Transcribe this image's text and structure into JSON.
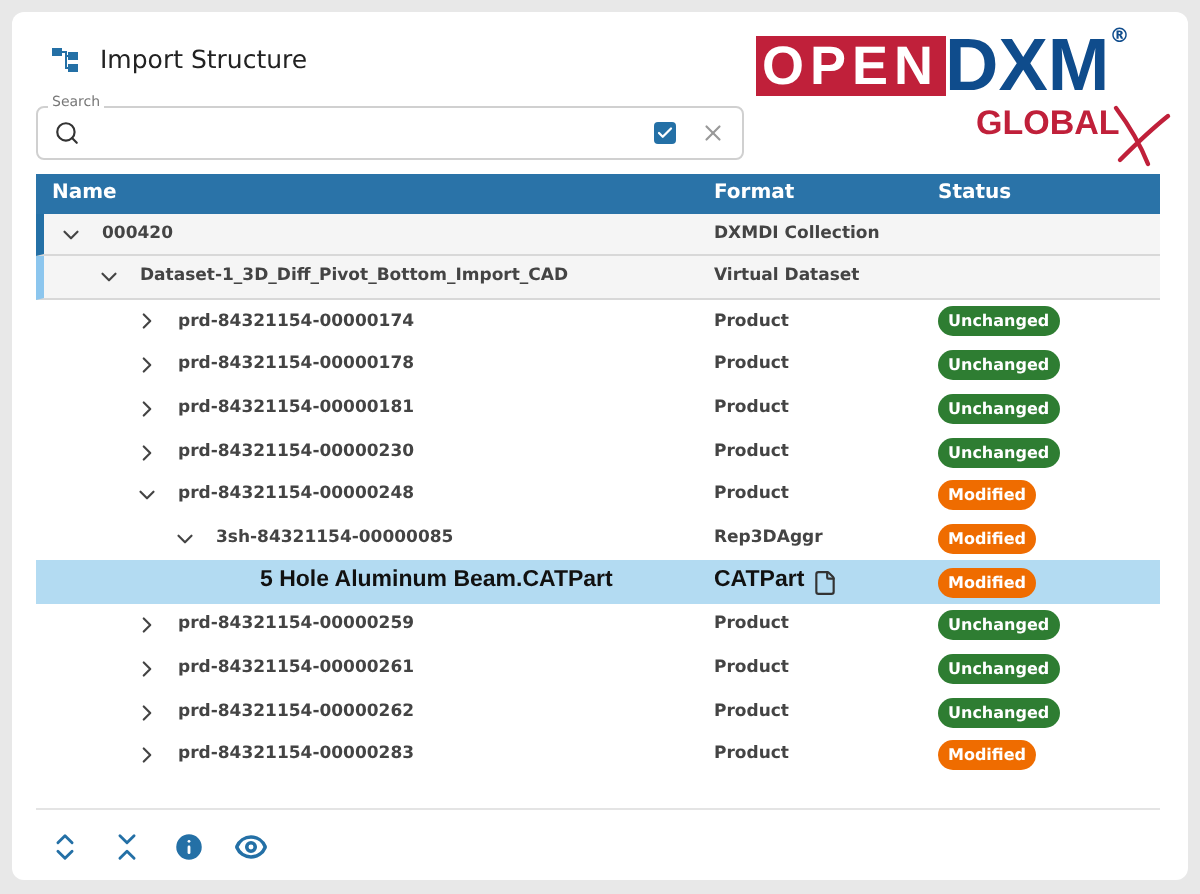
{
  "title": "Import Structure",
  "logo": {
    "open": "OPEN",
    "dxm": "DXM",
    "registered": "®",
    "global": "GLOBAL"
  },
  "search": {
    "label": "Search",
    "filter_checked": true
  },
  "table": {
    "columns": [
      "Name",
      "Format",
      "Status"
    ],
    "rows": [
      {
        "name": "000420",
        "format": "DXMDI Collection",
        "kind": "group",
        "expanded": true,
        "children": [
          {
            "name": "Dataset-1_3D_Diff_Pivot_Bottom_Import_CAD",
            "format": "Virtual Dataset",
            "kind": "group",
            "expanded": true,
            "children": [
              {
                "name": "prd-84321154-00000174",
                "format": "Product",
                "kind": "item",
                "expanded": false,
                "status": {
                  "label": "Unchanged",
                  "color": "#2e7d32"
                }
              },
              {
                "name": "prd-84321154-00000178",
                "format": "Product",
                "kind": "item",
                "expanded": false,
                "status": {
                  "label": "Unchanged",
                  "color": "#2e7d32"
                }
              },
              {
                "name": "prd-84321154-00000181",
                "format": "Product",
                "kind": "item",
                "expanded": false,
                "status": {
                  "label": "Unchanged",
                  "color": "#2e7d32"
                }
              },
              {
                "name": "prd-84321154-00000230",
                "format": "Product",
                "kind": "item",
                "expanded": false,
                "status": {
                  "label": "Unchanged",
                  "color": "#2e7d32"
                }
              },
              {
                "name": "prd-84321154-00000248",
                "format": "Product",
                "kind": "item",
                "expanded": true,
                "status": {
                  "label": "Modified",
                  "color": "#ef6c00"
                },
                "children": [
                  {
                    "name": "3sh-84321154-00000085",
                    "format": "Rep3DAggr",
                    "kind": "item",
                    "expanded": true,
                    "status": {
                      "label": "Modified",
                      "color": "#ef6c00"
                    },
                    "children": [
                      {
                        "name": "5 Hole Aluminum Beam.CATPart",
                        "format": "CATPart",
                        "kind": "file",
                        "selected": true,
                        "status": {
                          "label": "Modified",
                          "color": "#ef6c00"
                        }
                      }
                    ]
                  }
                ]
              },
              {
                "name": "prd-84321154-00000259",
                "format": "Product",
                "kind": "item",
                "expanded": false,
                "status": {
                  "label": "Unchanged",
                  "color": "#2e7d32"
                }
              },
              {
                "name": "prd-84321154-00000261",
                "format": "Product",
                "kind": "item",
                "expanded": false,
                "status": {
                  "label": "Unchanged",
                  "color": "#2e7d32"
                }
              },
              {
                "name": "prd-84321154-00000262",
                "format": "Product",
                "kind": "item",
                "expanded": false,
                "status": {
                  "label": "Unchanged",
                  "color": "#2e7d32"
                }
              },
              {
                "name": "prd-84321154-00000283",
                "format": "Product",
                "kind": "item",
                "expanded": false,
                "status": {
                  "label": "Modified",
                  "color": "#ef6c00"
                }
              }
            ]
          }
        ]
      }
    ]
  }
}
